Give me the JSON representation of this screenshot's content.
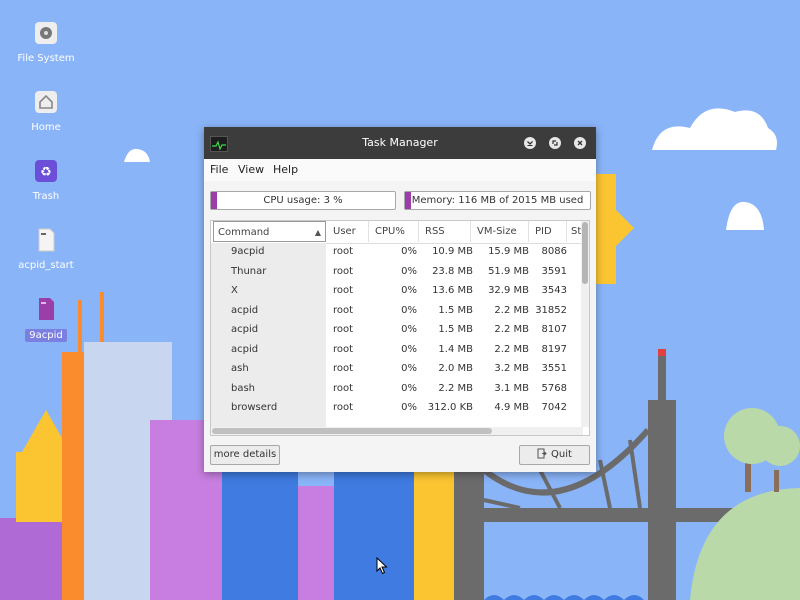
{
  "desktop": {
    "icons": [
      {
        "label": "File System",
        "icon": "hard-drive-icon"
      },
      {
        "label": "Home",
        "icon": "home-icon"
      },
      {
        "label": "Trash",
        "icon": "recycle-icon"
      },
      {
        "label": "acpid_start",
        "icon": "script-file-icon"
      },
      {
        "label": "9acpid",
        "icon": "executable-file-icon"
      }
    ]
  },
  "window": {
    "title": "Task Manager",
    "menu": [
      "File",
      "View",
      "Help"
    ],
    "cpu_label": "CPU usage: 3 %",
    "cpu_fraction": 0.03,
    "memory_label": "Memory: 116 MB of 2015 MB used",
    "memory_fraction": 0.058,
    "columns": [
      "Command",
      "User",
      "CPU%",
      "RSS",
      "VM-Size",
      "PID",
      "Sta"
    ],
    "rows": [
      {
        "cmd": "9acpid",
        "user": "root",
        "cpu": "0%",
        "rss": "10.9 MB",
        "vm": "15.9 MB",
        "pid": "8086"
      },
      {
        "cmd": "Thunar",
        "user": "root",
        "cpu": "0%",
        "rss": "23.8 MB",
        "vm": "51.9 MB",
        "pid": "3591"
      },
      {
        "cmd": "X",
        "user": "root",
        "cpu": "0%",
        "rss": "13.6 MB",
        "vm": "32.9 MB",
        "pid": "3543"
      },
      {
        "cmd": "acpid",
        "user": "root",
        "cpu": "0%",
        "rss": "1.5 MB",
        "vm": "2.2 MB",
        "pid": "31852"
      },
      {
        "cmd": "acpid",
        "user": "root",
        "cpu": "0%",
        "rss": "1.5 MB",
        "vm": "2.2 MB",
        "pid": "8107"
      },
      {
        "cmd": "acpid",
        "user": "root",
        "cpu": "0%",
        "rss": "1.4 MB",
        "vm": "2.2 MB",
        "pid": "8197"
      },
      {
        "cmd": "ash",
        "user": "root",
        "cpu": "0%",
        "rss": "2.0 MB",
        "vm": "3.2 MB",
        "pid": "3551"
      },
      {
        "cmd": "bash",
        "user": "root",
        "cpu": "0%",
        "rss": "2.2 MB",
        "vm": "3.1 MB",
        "pid": "5768"
      },
      {
        "cmd": "browserd",
        "user": "root",
        "cpu": "0%",
        "rss": "312.0 KB",
        "vm": "4.9 MB",
        "pid": "7042"
      }
    ],
    "more_details_label": "more details",
    "quit_label": "Quit"
  },
  "colors": {
    "desktop_bg": "#8ab4f8",
    "titlebar": "#3c3c3c",
    "meter_fill": "#9b3ea7",
    "selection": "#7a7fe0"
  }
}
